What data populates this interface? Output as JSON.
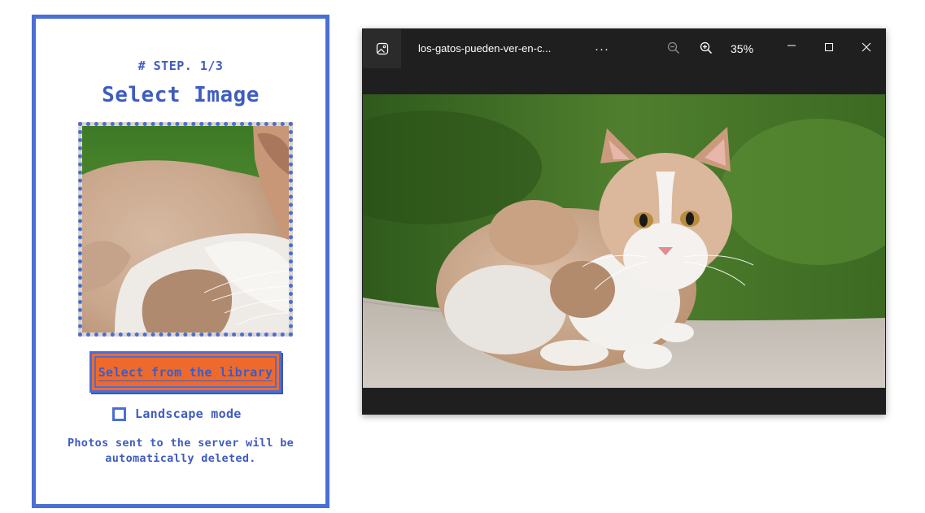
{
  "step_panel": {
    "step_label": "# STEP. 1/3",
    "title": "Select Image",
    "library_button_label": "Select from the library",
    "landscape_label": "Landscape mode",
    "landscape_checked": false,
    "note": "Photos sent to the server will be automatically deleted."
  },
  "viewer": {
    "filename": "los-gatos-pueden-ver-en-c...",
    "more_label": "···",
    "zoom_level": "35%"
  },
  "colors": {
    "accent_blue": "#4a6ed4",
    "button_orange": "#ee6a2c",
    "viewer_bg": "#1f1f1f"
  },
  "icons": {
    "app": "photos-app-icon",
    "zoom_out": "zoom-out-icon",
    "zoom_in": "zoom-in-icon",
    "minimize": "minimize-icon",
    "maximize": "maximize-icon",
    "close": "close-icon"
  }
}
